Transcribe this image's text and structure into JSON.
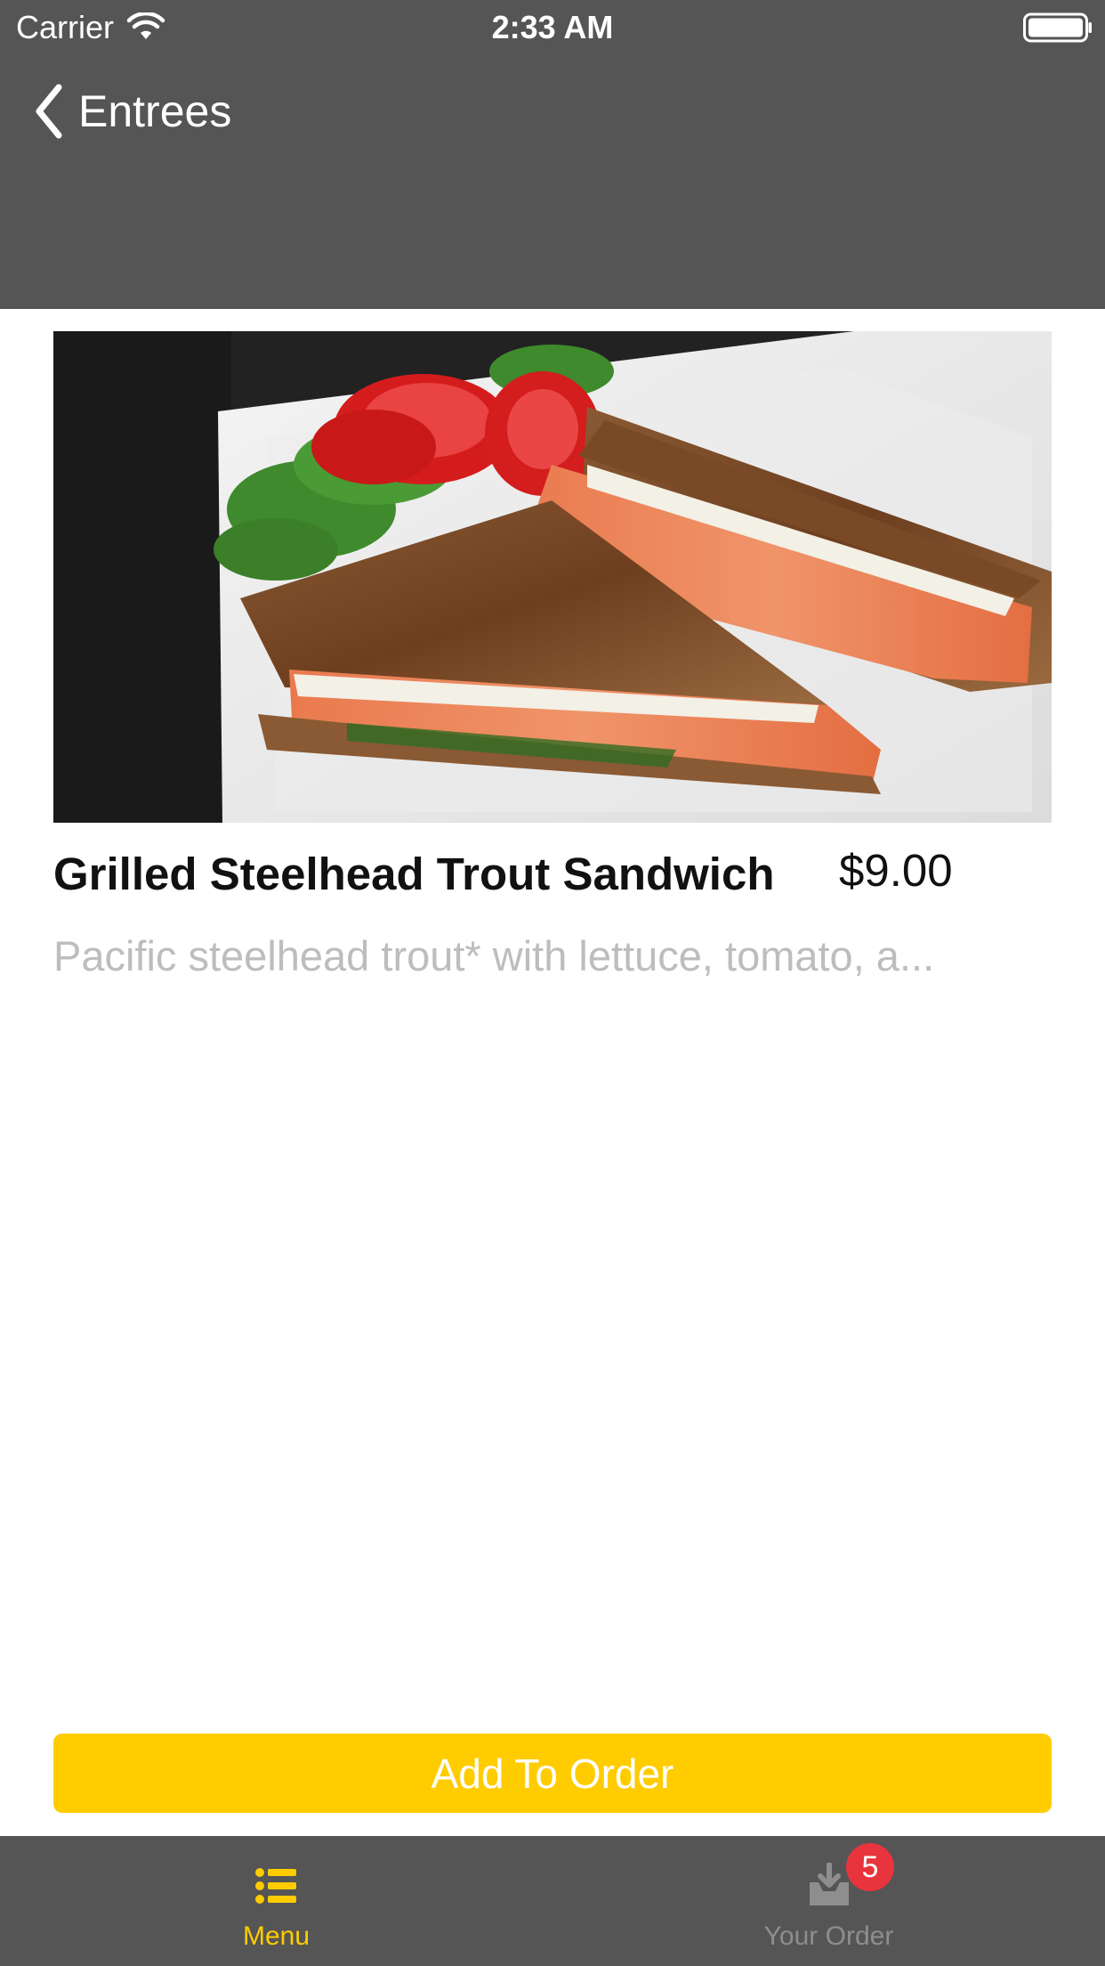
{
  "status_bar": {
    "carrier": "Carrier",
    "time": "2:33 AM"
  },
  "nav": {
    "back_label": "Entrees"
  },
  "item": {
    "title": "Grilled Steelhead Trout Sandwich",
    "price": "$9.00",
    "description": "Pacific steelhead trout* with lettuce, tomato, a..."
  },
  "actions": {
    "add_to_order_label": "Add To Order"
  },
  "tab_bar": {
    "tabs": [
      {
        "label": "Menu",
        "icon": "list-icon",
        "selected": true
      },
      {
        "label": "Your Order",
        "icon": "order-tray-icon",
        "selected": false,
        "badge": "5"
      }
    ]
  },
  "colors": {
    "header_bg": "#555555",
    "accent": "#ffcc00",
    "badge": "#e8343d",
    "description_text": "#bdbdbd"
  }
}
